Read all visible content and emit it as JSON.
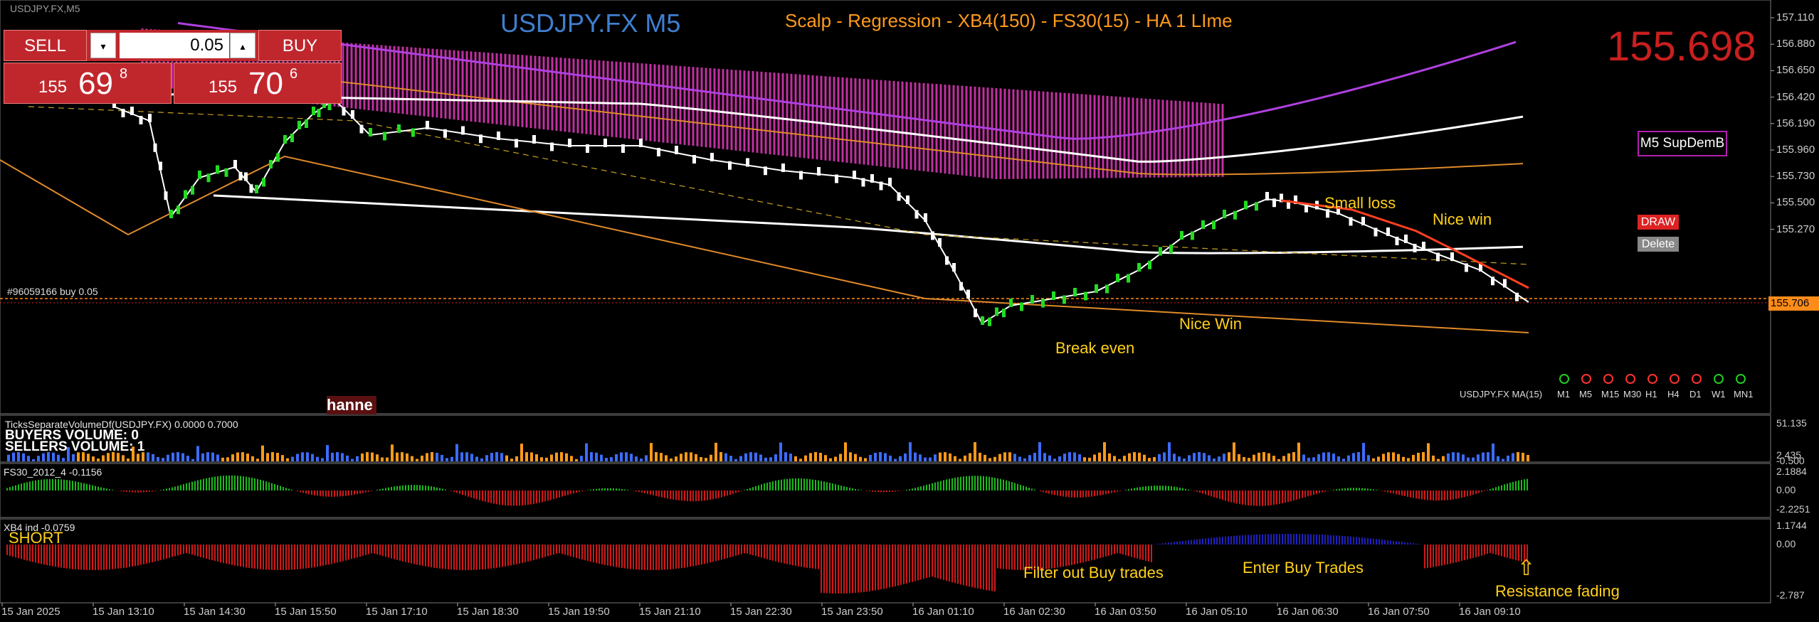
{
  "header": {
    "symbol_small": "USDJPY.FX,M5",
    "title": "USDJPY.FX M5",
    "strategy": "Scalp - Regression - XB4(150) - FS30(15) - HA  1 LIme",
    "big_price": "155.698"
  },
  "trade_panel": {
    "sell_label": "SELL",
    "buy_label": "BUY",
    "lot_value": "0.05",
    "spin_down": "▾",
    "spin_up": "▴",
    "sell_quote": {
      "prefix": "155",
      "big": "69",
      "sup": "8"
    },
    "buy_quote": {
      "prefix": "155",
      "big": "70",
      "sup": "6"
    }
  },
  "buttons": {
    "supdem": "M5 SupDemB",
    "draw": "DRAW",
    "delete": "Delete"
  },
  "position_label": "#96059166 buy 0.05",
  "current_price_tag": "155.706",
  "ma_label": "USDJPY.FX MA(15)",
  "timeframes": [
    {
      "label": "M1",
      "state": "up"
    },
    {
      "label": "M5",
      "state": "down"
    },
    {
      "label": "M15",
      "state": "down"
    },
    {
      "label": "M30",
      "state": "down"
    },
    {
      "label": "H1",
      "state": "down"
    },
    {
      "label": "H4",
      "state": "down"
    },
    {
      "label": "D1",
      "state": "down"
    },
    {
      "label": "W1",
      "state": "up"
    },
    {
      "label": "MN1",
      "state": "up"
    }
  ],
  "colors": {
    "up": "#22cc22",
    "down": "#ff3030",
    "buyer_volume": "#3c6cff",
    "seller_volume": "#ff9a1a",
    "fs30_up": "#1cba1c",
    "fs30_down": "#d01818",
    "xb4_up": "#2020c0",
    "xb4_down": "#d01818"
  },
  "annotations": {
    "small_loss": "Small loss",
    "nice_win_top": "Nice win",
    "nice_win_mid": "Nice Win",
    "break_even": "Break even",
    "filter_out": "Filter out Buy trades",
    "enter_buy": "Enter Buy Trades",
    "resistance": "Resistance fading",
    "short": "SHORT",
    "arrow": "⇧"
  },
  "hanne_label": "hanne",
  "main_price_axis": [
    "157.110",
    "156.880",
    "156.650",
    "156.420",
    "156.190",
    "155.960",
    "155.730",
    "155.500",
    "155.270"
  ],
  "panels": {
    "volume": {
      "title": "TicksSeparateVolumeDf(USDJPY.FX) 0.0000 0.7000",
      "buyers": "BUYERS VOLUME: 0",
      "sellers": "SELLERS VOLUME: 1",
      "axis": [
        "51.135",
        "2.435",
        "-0.500"
      ]
    },
    "fs30": {
      "title": "FS30_2012_4 -0.1156",
      "axis": [
        "2.1884",
        "0.00",
        "-2.2251"
      ]
    },
    "xb4": {
      "title": "XB4 ind -0.0759",
      "axis": [
        "1.1744",
        "0.00",
        "-2.787"
      ]
    }
  },
  "time_axis": [
    "15 Jan 2025",
    "15 Jan 13:10",
    "15 Jan 14:30",
    "15 Jan 15:50",
    "15 Jan 17:10",
    "15 Jan 18:30",
    "15 Jan 19:50",
    "15 Jan 21:10",
    "15 Jan 22:30",
    "15 Jan 23:50",
    "16 Jan 01:10",
    "16 Jan 02:30",
    "16 Jan 03:50",
    "16 Jan 05:10",
    "16 Jan 06:30",
    "16 Jan 07:50",
    "16 Jan 09:10"
  ]
}
